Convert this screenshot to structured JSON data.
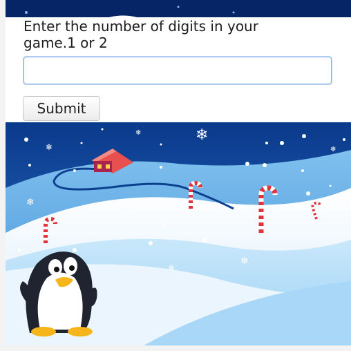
{
  "form": {
    "prompt_text": "Enter the number of digits in your game.1 or 2",
    "input_value": "",
    "submit_label": "Submit"
  },
  "colors": {
    "top_band": "#062566",
    "sky_top": "#0a3a8c",
    "sky_bottom": "#2f75c8",
    "input_focus_border": "#8db2e6",
    "page_background": "#ffffff",
    "outer_background": "#f3f3f4"
  },
  "scene": {
    "description_icons": [
      "snowflake-icon",
      "house-icon",
      "candy-cane-icon",
      "penguin-icon"
    ]
  }
}
